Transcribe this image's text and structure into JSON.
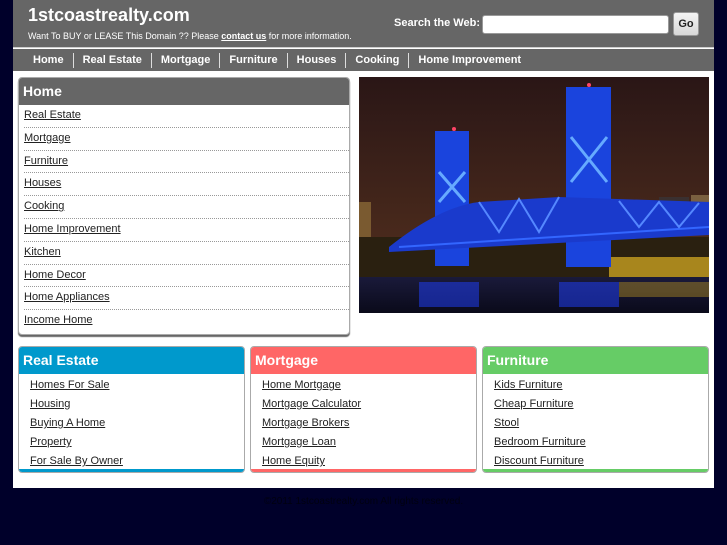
{
  "header": {
    "site_title": "1stcoastrealty.com",
    "tagline_before": "Want To BUY or LEASE This Domain ?? Please ",
    "tagline_link": "contact us",
    "tagline_after": " for more information.",
    "search_label": "Search the Web:",
    "search_value": "",
    "go_label": "Go"
  },
  "nav": {
    "items": [
      {
        "label": "Home"
      },
      {
        "label": "Real Estate"
      },
      {
        "label": "Mortgage"
      },
      {
        "label": "Furniture"
      },
      {
        "label": "Houses"
      },
      {
        "label": "Cooking"
      },
      {
        "label": "Home Improvement"
      }
    ]
  },
  "sidebar": {
    "title": "Home",
    "links": [
      {
        "label": "Real Estate"
      },
      {
        "label": "Mortgage"
      },
      {
        "label": "Furniture"
      },
      {
        "label": "Houses"
      },
      {
        "label": "Cooking"
      },
      {
        "label": "Home Improvement"
      },
      {
        "label": "Kitchen"
      },
      {
        "label": "Home Decor"
      },
      {
        "label": "Home Appliances"
      },
      {
        "label": "Income Home"
      }
    ]
  },
  "photo": {
    "description": "Blue-lit lift bridge over river at night"
  },
  "boxes": [
    {
      "title": "Real Estate",
      "color": "#0099cc",
      "links": [
        "Homes For Sale",
        "Housing",
        "Buying A Home",
        "Property",
        "For Sale By Owner"
      ]
    },
    {
      "title": "Mortgage",
      "color": "#ff6666",
      "links": [
        "Home Mortgage",
        "Mortgage Calculator",
        "Mortgage Brokers",
        "Mortgage Loan",
        "Home Equity"
      ]
    },
    {
      "title": "Furniture",
      "color": "#66cc66",
      "links": [
        "Kids Furniture",
        "Cheap Furniture",
        "Stool",
        "Bedroom Furniture",
        "Discount Furniture"
      ]
    }
  ],
  "footer": {
    "copyright": "©2011 1stcoastrealty.com All rights reserved."
  },
  "colors": {
    "page_bg": "#00002a",
    "header_bg": "#666666"
  }
}
